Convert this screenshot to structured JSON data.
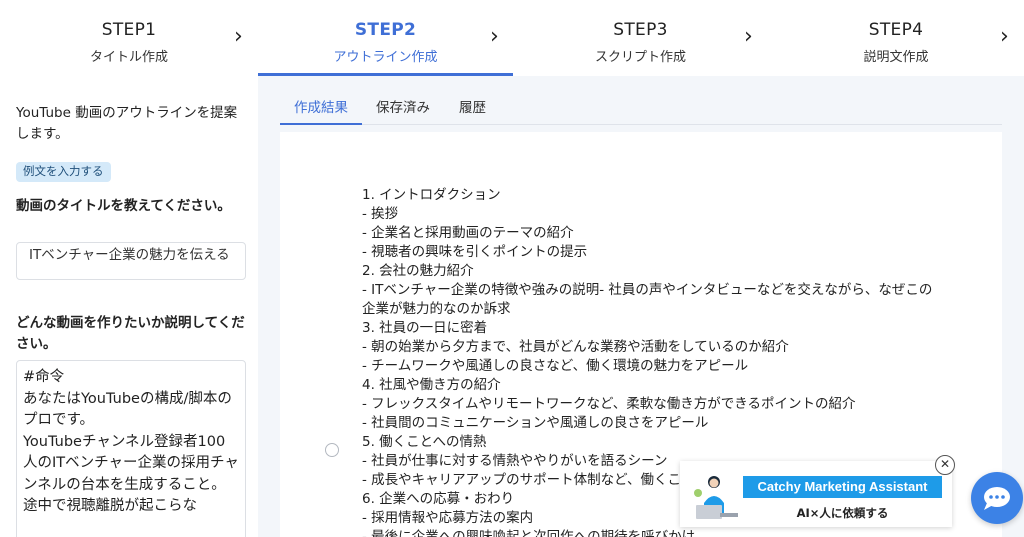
{
  "steps": [
    {
      "num": "STEP1",
      "label": "タイトル作成"
    },
    {
      "num": "STEP2",
      "label": "アウトライン作成"
    },
    {
      "num": "STEP3",
      "label": "スクリプト作成"
    },
    {
      "num": "STEP4",
      "label": "説明文作成"
    }
  ],
  "colors": {
    "accent": "#3f6fd6",
    "banner_brand": "#1e9be8",
    "chat": "#3c82e6"
  },
  "sidebar": {
    "description": "YouTube 動画のアウトラインを提案します。",
    "example_button": "例文を入力する",
    "title_question": "動画のタイトルを教えてください。",
    "title_value": "ITベンチャー企業の魅力を伝える",
    "video_question": "どんな動画を作りたいか説明してください。",
    "video_value": "#命令\nあなたはYouTubeの構成/脚本のプロです。\nYouTubeチャンネル登録者100人のITベンチャー企業の採用チャンネルの台本を生成すること。\n途中で視聴離脱が起こらな"
  },
  "tabs": [
    "作成結果",
    "保存済み",
    "履歴"
  ],
  "outline": [
    "1.  イントロダクション",
    "- 挨拶",
    "- 企業名と採用動画のテーマの紹介",
    "- 視聴者の興味を引くポイントの提示",
    "2.  会社の魅力紹介",
    "- ITベンチャー企業の特徴や強みの説明- 社員の声やインタビューなどを交えながら、なぜこの",
    "企業が魅力的なのか訴求",
    "3.  社員の一日に密着",
    "- 朝の始業から夕方まで、社員がどんな業務や活動をしているのか紹介",
    "- チームワークや風通しの良さなど、働く環境の魅力をアピール",
    "4.  社風や働き方の紹介",
    "- フレックスタイムやリモートワークなど、柔軟な働き方ができるポイントの紹介",
    "- 社員間のコミュニケーションや風通しの良さをアピール",
    "5.  働くことへの情熱",
    "- 社員が仕事に対する情熱ややりがいを語るシーン",
    "- 成長やキャリアアップのサポート体制など、働くこ",
    "6.  企業への応募・おわり",
    "- 採用情報や応募方法の案内",
    "- 最後に企業への興味喚起と次回作への期待を呼びかけ"
  ],
  "banner": {
    "brand": "Catchy Marketing Assistant",
    "sub": "AI×人に依頼する"
  },
  "icons": {
    "chevron": "chevron-right-icon",
    "close": "close-icon",
    "chat": "chat-bubble-icon"
  }
}
